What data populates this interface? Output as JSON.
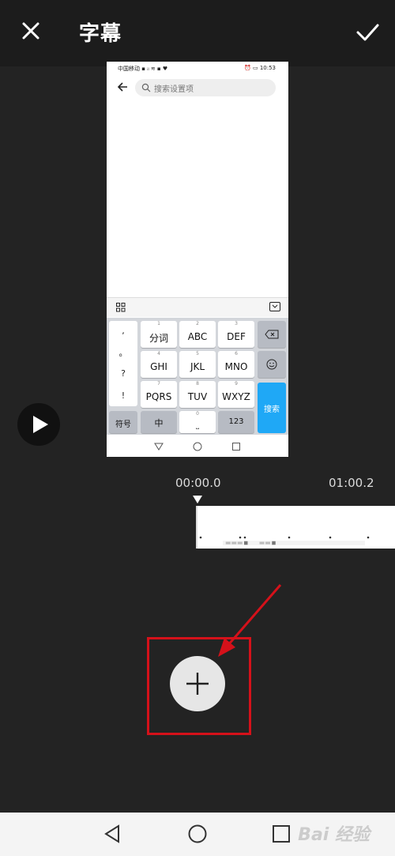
{
  "header": {
    "title": "字幕",
    "close_icon": "close-icon",
    "confirm_icon": "check-icon"
  },
  "preview": {
    "status_left": "中国移动 ▪ ᵢₗ ≋ ▪ ♥",
    "status_right": "⏰ ▭ 10:53",
    "search_placeholder": "搜索设置项",
    "keyboard": {
      "punct": [
        ",",
        "。",
        "?",
        "!"
      ],
      "row1": [
        {
          "n": "1",
          "t": "分词"
        },
        {
          "n": "2",
          "t": "ABC"
        },
        {
          "n": "3",
          "t": "DEF"
        }
      ],
      "row2": [
        {
          "n": "4",
          "t": "GHI"
        },
        {
          "n": "5",
          "t": "JKL"
        },
        {
          "n": "6",
          "t": "MNO"
        }
      ],
      "row3": [
        {
          "n": "7",
          "t": "PQRS"
        },
        {
          "n": "8",
          "t": "TUV"
        },
        {
          "n": "9",
          "t": "WXYZ"
        }
      ],
      "bottom": {
        "symbols": "符号",
        "chinese": "中",
        "space_num": "0",
        "num": "123"
      },
      "search_label": "搜索"
    }
  },
  "timeline": {
    "start_time": "00:00.0",
    "end_time": "01:00.2"
  },
  "colors": {
    "highlight": "#d5111a",
    "accent_blue": "#1fa8f6"
  },
  "watermark": "Bai 经验"
}
